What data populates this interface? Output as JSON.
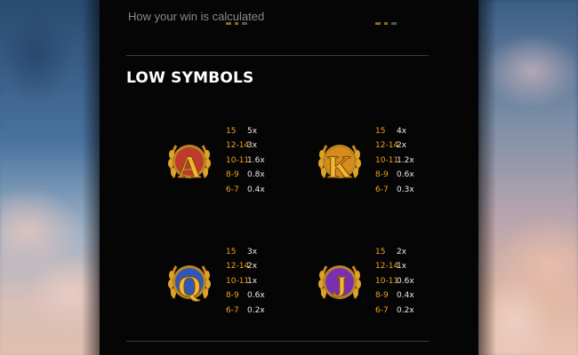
{
  "calc_text": "How your win is calculated",
  "section_title": "LOW SYMBOLS",
  "colors": {
    "accent_orange": "#f0a21c",
    "gold": "#e5a92a",
    "panel_bg": "#050505"
  },
  "symbols": [
    {
      "letter": "A",
      "medallion_color": "#c0392b",
      "paytable": [
        {
          "count": "15",
          "mult": "5x"
        },
        {
          "count": "12-14",
          "mult": "3x"
        },
        {
          "count": "10-11",
          "mult": "1.6x"
        },
        {
          "count": "8-9",
          "mult": "0.8x"
        },
        {
          "count": "6-7",
          "mult": "0.4x"
        }
      ]
    },
    {
      "letter": "K",
      "medallion_color": "#d98a1c",
      "paytable": [
        {
          "count": "15",
          "mult": "4x"
        },
        {
          "count": "12-14",
          "mult": "2x"
        },
        {
          "count": "10-11",
          "mult": "1.2x"
        },
        {
          "count": "8-9",
          "mult": "0.6x"
        },
        {
          "count": "6-7",
          "mult": "0.3x"
        }
      ]
    },
    {
      "letter": "Q",
      "medallion_color": "#2f57b8",
      "paytable": [
        {
          "count": "15",
          "mult": "3x"
        },
        {
          "count": "12-14",
          "mult": "2x"
        },
        {
          "count": "10-11",
          "mult": "1x"
        },
        {
          "count": "8-9",
          "mult": "0.6x"
        },
        {
          "count": "6-7",
          "mult": "0.2x"
        }
      ]
    },
    {
      "letter": "J",
      "medallion_color": "#7a2fb0",
      "paytable": [
        {
          "count": "15",
          "mult": "2x"
        },
        {
          "count": "12-14",
          "mult": "1x"
        },
        {
          "count": "10-11",
          "mult": "0.6x"
        },
        {
          "count": "8-9",
          "mult": "0.4x"
        },
        {
          "count": "6-7",
          "mult": "0.2x"
        }
      ]
    }
  ]
}
